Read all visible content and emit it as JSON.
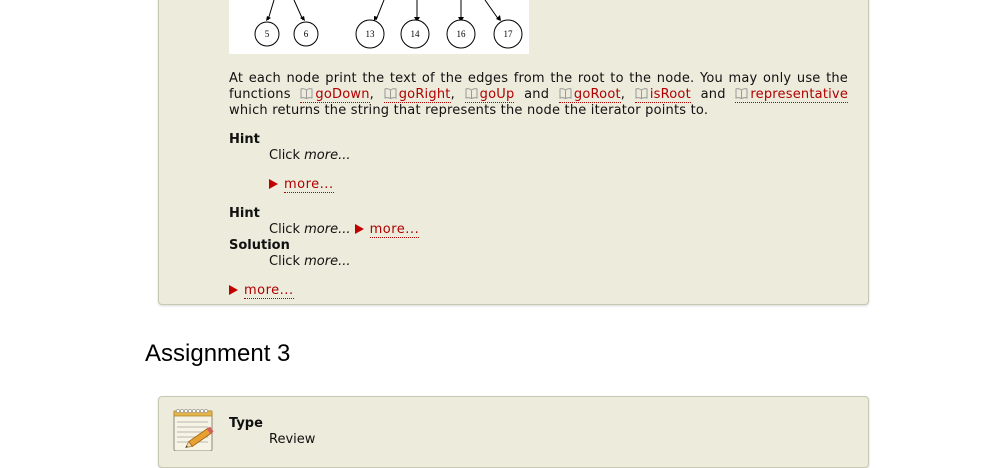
{
  "tree": {
    "nodes": [
      "5",
      "6",
      "13",
      "14",
      "16",
      "17"
    ]
  },
  "exercise": {
    "text_before": "At each node print the text of the edges from the root to the node. You may only use the functions",
    "functions": [
      "goDown",
      "goRight",
      "goUp",
      "goRoot",
      "isRoot",
      "representative"
    ],
    "sep_comma": ",",
    "sep_and": "and",
    "text_after": "which returns the string that represents the node the iterator points to.",
    "hint1_label": "Hint",
    "hint1_click": "Click",
    "hint1_more_em": "more...",
    "hint1_more_link": "more...",
    "hint2_label": "Hint",
    "hint2_click": "Click",
    "hint2_more_em": "more...",
    "hint2_more_link": "more...",
    "solution_label": "Solution",
    "solution_click": "Click",
    "solution_more_em": "more...",
    "solution_more_link": "more..."
  },
  "assignment3": {
    "title": "Assignment 3",
    "type_label": "Type",
    "type_value": "Review"
  },
  "colors": {
    "box_bg": "#ecebdc",
    "link": "#b00000"
  },
  "icons": [
    "book-icon",
    "disclosure-triangle-icon",
    "notepad-pencil-icon"
  ]
}
